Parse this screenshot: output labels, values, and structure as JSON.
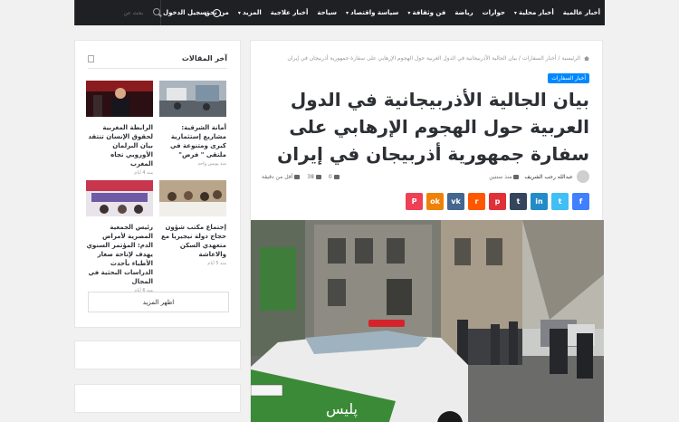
{
  "nav": {
    "items": [
      {
        "label": "أخبار عالمية",
        "caret": false
      },
      {
        "label": "أخبار محلية",
        "caret": true
      },
      {
        "label": "حوارات",
        "caret": false
      },
      {
        "label": "رياضة",
        "caret": false
      },
      {
        "label": "فن وثقافة",
        "caret": true
      },
      {
        "label": "سياسة واقتصاد",
        "caret": true
      },
      {
        "label": "سياحة",
        "caret": false
      },
      {
        "label": "أخبار علاجية",
        "caret": false
      },
      {
        "label": "المزيد",
        "caret": true
      },
      {
        "label": "من نحن",
        "caret": false
      }
    ],
    "login_label": "تسجيل الدخول",
    "search_placeholder": "بحث عن"
  },
  "article": {
    "breadcrumb": "الرئيسية / أخبار السفارات / بيان الجالية الأذربيجانية في الدول العربية حول الهجوم الإرهابي على سفارة جمهورية أذربيجان في إيران",
    "category": "أخبار السفارات",
    "title": "بيان الجالية الأذربيجانية في الدول العربية حول الهجوم الإرهابي على سفارة جمهورية أذربيجان في إيران",
    "author": "عبدالله رجب الشريف",
    "date": "منذ سنتين",
    "comments": "0",
    "views": "38",
    "read_time": "أقل من دقيقة",
    "share_buttons": [
      {
        "name": "facebook",
        "glyph": "f",
        "color": "#4080ff"
      },
      {
        "name": "twitter",
        "glyph": "t",
        "color": "#40bff5"
      },
      {
        "name": "linkedin",
        "glyph": "in",
        "color": "#238cc8"
      },
      {
        "name": "tumblr",
        "glyph": "t",
        "color": "#35465c"
      },
      {
        "name": "pinterest",
        "glyph": "p",
        "color": "#e13138"
      },
      {
        "name": "reddit",
        "glyph": "r",
        "color": "#ff5700"
      },
      {
        "name": "vk",
        "glyph": "vk",
        "color": "#45668e"
      },
      {
        "name": "odnoklassniki",
        "glyph": "ok",
        "color": "#ee8208"
      },
      {
        "name": "pocket",
        "glyph": "P",
        "color": "#ef4056"
      }
    ],
    "photo_sign": "پلیس"
  },
  "sidebar": {
    "title": "آخر المقالات",
    "posts": [
      {
        "title": "أمانة الشرقية: مشاريع إستثمارية كبرى ومتنوعة في ملتقى \" فرص\"",
        "date": "منذ يومين واحد"
      },
      {
        "title": "الرابطة المغربية لحقوق الإنسان تنتقد بيان البرلمان الأوروبي تجاه المغرب",
        "date": "منذ 4 أيام"
      },
      {
        "title": "إجتماع مكتب شؤون حجاج دولة نيجيريا مع متعهدي السكن والاعاشة",
        "date": "منذ 5 أيام"
      },
      {
        "title": "رئيس الجمعية المصرية لأمراض الدم: المؤتمر السنوي يهدف لإتاحة صغار الأطباء بأحدث الدراسات البحثية في المجال",
        "date": "منذ 6 أيام"
      }
    ],
    "more_label": "اظهر المزيد"
  }
}
